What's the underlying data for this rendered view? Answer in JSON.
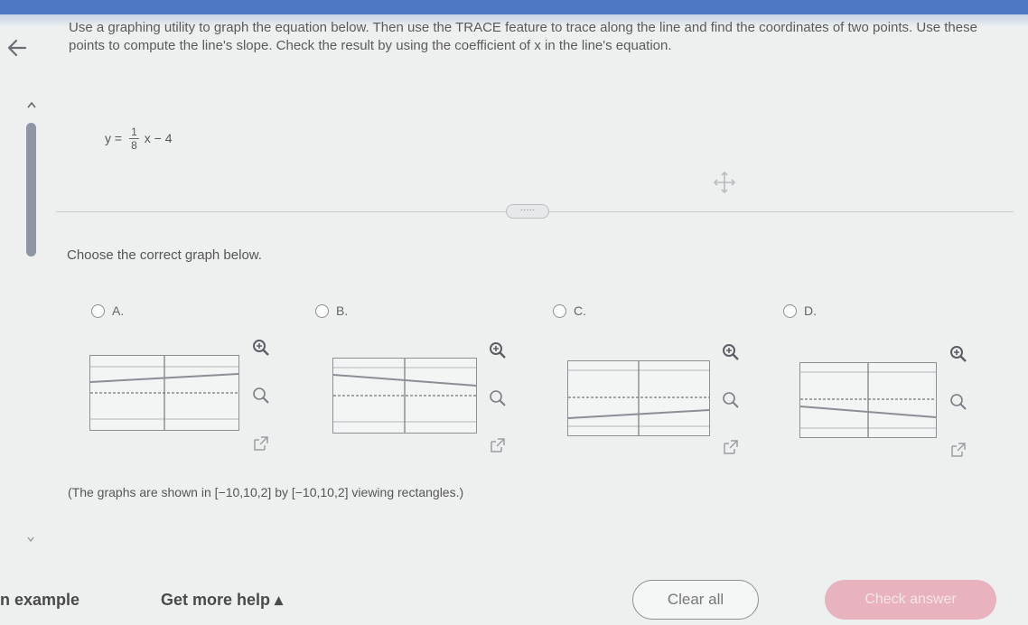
{
  "instructions": "Use a graphing utility to graph the equation below. Then use the TRACE feature to trace along the line and find the coordinates of two points. Use these points to compute the line's slope. Check the result by using the coefficient of x in the line's equation.",
  "equation": {
    "lhs": "y =",
    "numerator": "1",
    "denominator": "8",
    "rhs": "x − 4"
  },
  "expander_label": "·····",
  "prompt": "Choose the correct graph below.",
  "options": [
    {
      "label": "A."
    },
    {
      "label": "B."
    },
    {
      "label": "C."
    },
    {
      "label": "D."
    }
  ],
  "note": "(The graphs are shown in [−10,10,2] by [−10,10,2] viewing rectangles.)",
  "footer": {
    "example_link": "n example",
    "help_link": "Get more help ▴",
    "clear_button": "Clear all",
    "check_button": "Check answer"
  },
  "colors": {
    "top_bar": "#4c78c4",
    "check_button": "#e8b3bf",
    "scroll_thumb": "#8e96a6"
  },
  "icons": [
    "back-arrow-icon",
    "zoom-in-icon",
    "zoom-out-icon",
    "expand-icon",
    "move-icon"
  ]
}
